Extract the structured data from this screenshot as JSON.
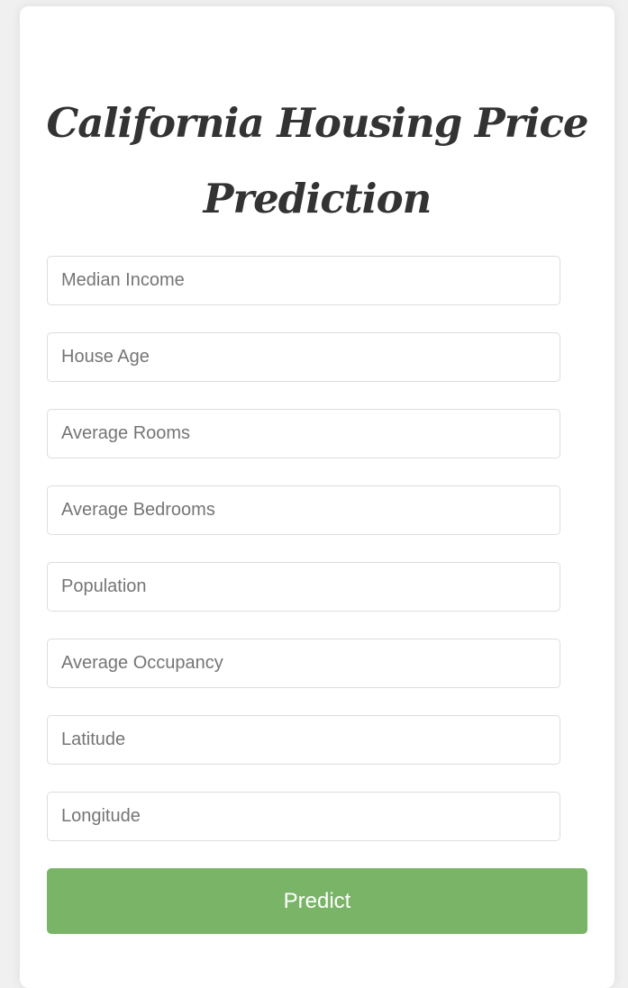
{
  "title": "California Housing Price Prediction",
  "fields": [
    {
      "name": "median-income-input",
      "placeholder": "Median Income",
      "value": ""
    },
    {
      "name": "house-age-input",
      "placeholder": "House Age",
      "value": ""
    },
    {
      "name": "average-rooms-input",
      "placeholder": "Average Rooms",
      "value": ""
    },
    {
      "name": "average-bedrooms-input",
      "placeholder": "Average Bedrooms",
      "value": ""
    },
    {
      "name": "population-input",
      "placeholder": "Population",
      "value": ""
    },
    {
      "name": "average-occupancy-input",
      "placeholder": "Average Occupancy",
      "value": ""
    },
    {
      "name": "latitude-input",
      "placeholder": "Latitude",
      "value": ""
    },
    {
      "name": "longitude-input",
      "placeholder": "Longitude",
      "value": ""
    }
  ],
  "predict_button": {
    "label": "Predict"
  },
  "colors": {
    "background": "#f0f0f0",
    "card": "#ffffff",
    "accent": "#7ab567",
    "title_text": "#333333"
  }
}
